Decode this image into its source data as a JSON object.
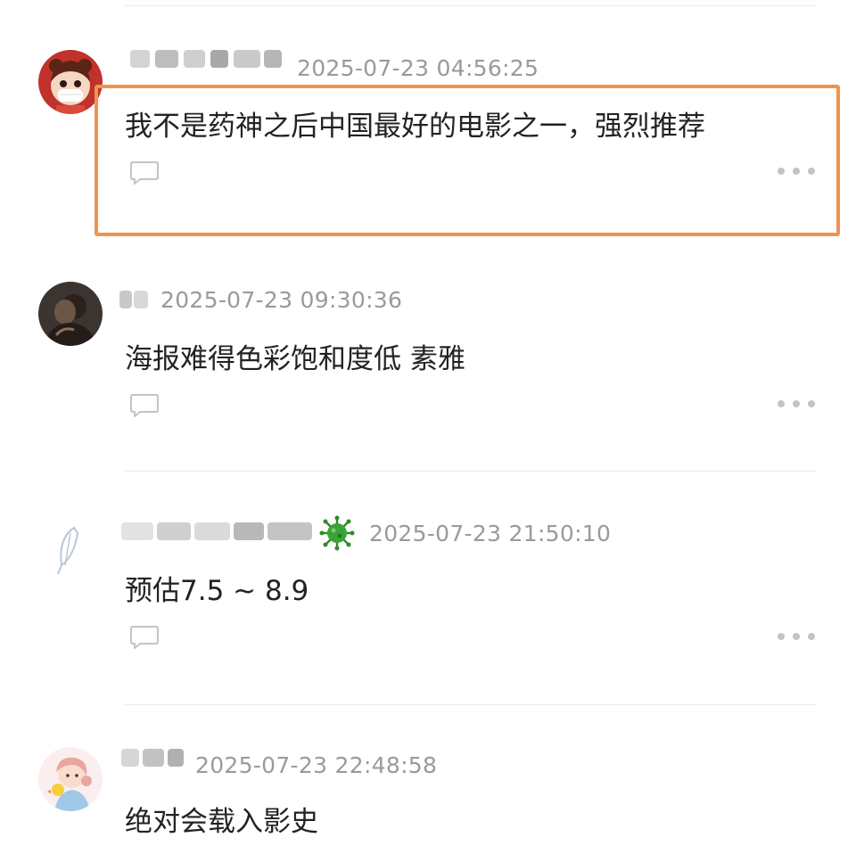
{
  "comments": [
    {
      "username": "",
      "timestamp": "2025-07-23 04:56:25",
      "text": "我不是药神之后中国最好的电影之一，强烈推荐",
      "reply_icon": "comment-bubble-icon",
      "more_icon": "more-dots-icon",
      "avatar": "girl-with-mask-avatar",
      "highlighted": true
    },
    {
      "username": "",
      "timestamp": "2025-07-23 09:30:36",
      "text": "海报难得色彩饱和度低 素雅",
      "reply_icon": "comment-bubble-icon",
      "more_icon": "more-dots-icon",
      "avatar": "dark-photo-avatar"
    },
    {
      "username": "",
      "timestamp": "2025-07-23 21:50:10",
      "text": "预估7.5 ~ 8.9",
      "reply_icon": "comment-bubble-icon",
      "more_icon": "more-dots-icon",
      "avatar": "feather-avatar",
      "badge": "virus-badge-icon"
    },
    {
      "username": "",
      "timestamp": "2025-07-23 22:48:58",
      "text": "绝对会载入影史",
      "avatar": "girl-with-duck-avatar"
    }
  ],
  "colors": {
    "highlight_border": "#ef9350",
    "timestamp": "#9a9a9a",
    "text": "#222222",
    "icon_gray": "#c4c4c4",
    "divider": "#ececec"
  }
}
